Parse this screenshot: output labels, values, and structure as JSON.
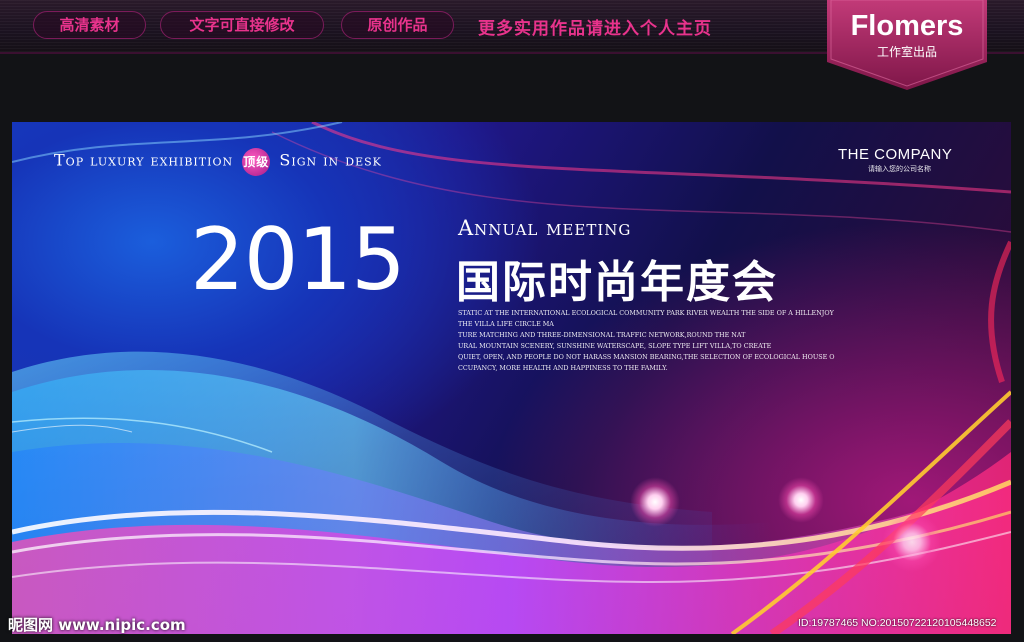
{
  "header": {
    "pills": [
      "高清素材",
      "文字可直接修改",
      "原创作品"
    ],
    "promo_text": "更多实用作品请进入个人主页",
    "brand": {
      "name": "Flomers",
      "subtitle": "工作室出品"
    }
  },
  "banner": {
    "top_tag_left": "Top luxury exhibition",
    "top_tag_chip": "顶级",
    "top_tag_right": "Sign in desk",
    "company": "THE COMPANY",
    "company_sub": "请输入您的公司名称",
    "year": "2015",
    "annual": "Annual meeting",
    "title_cn": "国际时尚年度会",
    "paragraph": [
      "STATIC AT THE INTERNATIONAL ECOLOGICAL COMMUNITY PARK RIVER WEALTH THE SIDE OF A HILLENJOY",
      "THE VILLA LIFE CIRCLE MA",
      "TURE MATCHING AND THREE-DIMENSIONAL TRAFFIC NETWORK,ROUND THE NAT",
      "URAL MOUNTAIN SCENERY, SUNSHINE WATERSCAPE, SLOPE TYPE LIFT VILLA,TO CREATE",
      "QUIET, OPEN, AND PEOPLE DO NOT HARASS MANSION BEARING,THE SELECTION OF ECOLOGICAL HOUSE O",
      "CCUPANCY, MORE HEALTH AND HAPPINESS TO THE FAMILY."
    ]
  },
  "watermark": {
    "site": "昵图网 www.nipic.com",
    "id_line": "ID:19787465 NO:20150722120105448652"
  },
  "colors": {
    "accent": "#e8338c",
    "background": "#121316",
    "badge": "#a0265e"
  }
}
